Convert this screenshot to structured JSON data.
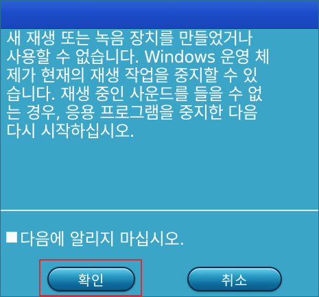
{
  "dialog": {
    "message": "새 재생 또는 녹음 장치를 만들었거나\n사용할 수 없습니다. Windows 운영 체\n제가 현재의 재생 작업을 중지할 수 있\n습니다. 재생 중인 사운드를 들을 수 없\n는 경우, 응용 프로그램을 중지한 다음\n다시 시작하십시오.",
    "checkbox_label": "다음에 알리지 마십시오.",
    "checkbox_checked": false,
    "ok_label": "확인",
    "cancel_label": "취소",
    "highlight_color": "#e8262d",
    "background_color": "#3aa5c6",
    "titlebar_color": "#1c4cc8"
  }
}
